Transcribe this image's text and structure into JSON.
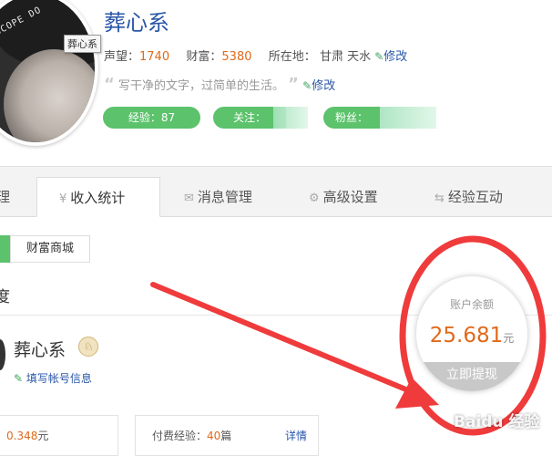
{
  "profile": {
    "username": "葬心系",
    "avatar_tooltip": "葬心系",
    "avatar_hood_text": "SCOPE DO",
    "stats": [
      {
        "label": "声望：",
        "value": "1740"
      },
      {
        "label": "财富：",
        "value": "5380"
      }
    ],
    "location_label": "所在地：",
    "location_value": "甘肃 天水",
    "edit_label": "修改",
    "motto": "写干净的文字，过简单的生活。",
    "pills": {
      "experience": "经验：87",
      "follow": "关注：",
      "fans": "粉丝："
    }
  },
  "tabs": [
    {
      "label": "理",
      "icon": ""
    },
    {
      "label": "收入统计",
      "icon": "yen-icon"
    },
    {
      "label": "消息管理",
      "icon": "mail-icon"
    },
    {
      "label": "高级设置",
      "icon": "gear-icon"
    },
    {
      "label": "经验互动",
      "icon": "exchange-icon"
    }
  ],
  "main": {
    "shop_button": "财富商城",
    "section_title": "度",
    "account_name": "葬心系",
    "badge_icon": "♘",
    "fill_info": "填写帐号信息",
    "box_left": {
      "value": "0.348",
      "unit": "元"
    },
    "box_right": {
      "label": "付费经验：",
      "value": "40",
      "unit": "篇",
      "link": "详情"
    }
  },
  "balance": {
    "label": "账户余额",
    "amount": "25.681",
    "unit": "元",
    "withdraw_button": "立即提现"
  },
  "annotation_color": "#ef3b3b",
  "watermark": "Baidu 经验"
}
